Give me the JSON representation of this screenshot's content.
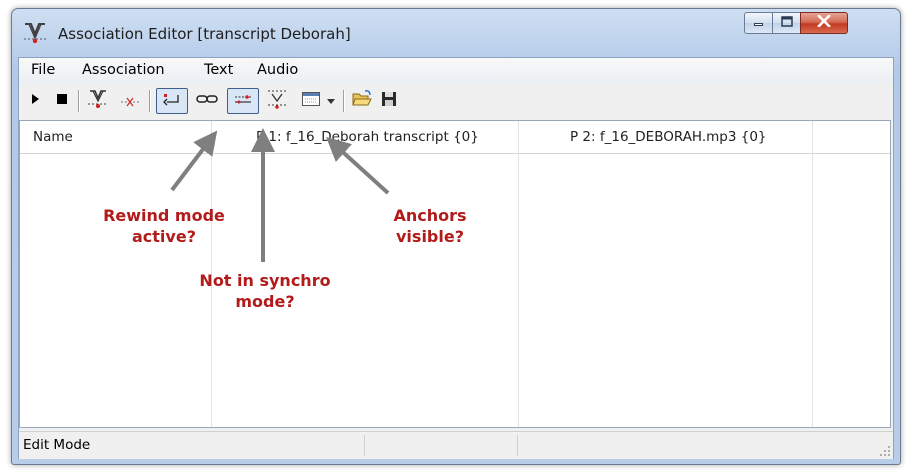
{
  "window": {
    "title": "Association Editor [transcript Deborah]",
    "icon": "association-editor-app-icon",
    "controls": [
      "minimize-icon",
      "maximize-icon",
      "close-icon"
    ]
  },
  "menubar": {
    "items": [
      {
        "label": "File"
      },
      {
        "label": "Association"
      },
      {
        "label": "Text"
      },
      {
        "label": "Audio"
      }
    ]
  },
  "toolbar": {
    "buttons": [
      {
        "icon": "play-icon"
      },
      {
        "icon": "stop-icon"
      },
      {
        "icon": "add-association-icon"
      },
      {
        "icon": "remove-association-icon"
      },
      {
        "icon": "rewind-mode-icon",
        "active": true
      },
      {
        "icon": "synchro-link-icon"
      },
      {
        "icon": "anchors-visible-icon",
        "active": true
      },
      {
        "icon": "align-icon"
      },
      {
        "icon": "view-grid-icon"
      },
      {
        "icon": "dropdown-arrow-icon"
      },
      {
        "icon": "open-folder-icon"
      },
      {
        "icon": "save-disk-icon"
      }
    ]
  },
  "table": {
    "columns": [
      {
        "label": "Name"
      },
      {
        "label": "P 1: f_16_Deborah transcript {0}"
      },
      {
        "label": "P 2: f_16_DEBORAH.mp3 {0}"
      }
    ],
    "rows": []
  },
  "statusbar": {
    "text": "Edit Mode"
  },
  "annotations": {
    "rewind_line1": "Rewind mode",
    "rewind_line2": "active?",
    "synchro_line1": "Not in synchro",
    "synchro_line2": "mode?",
    "anchors_line1": "Anchors",
    "anchors_line2": "visible?",
    "color": "#b31b1b",
    "arrow_color": "#7f7f7f"
  }
}
